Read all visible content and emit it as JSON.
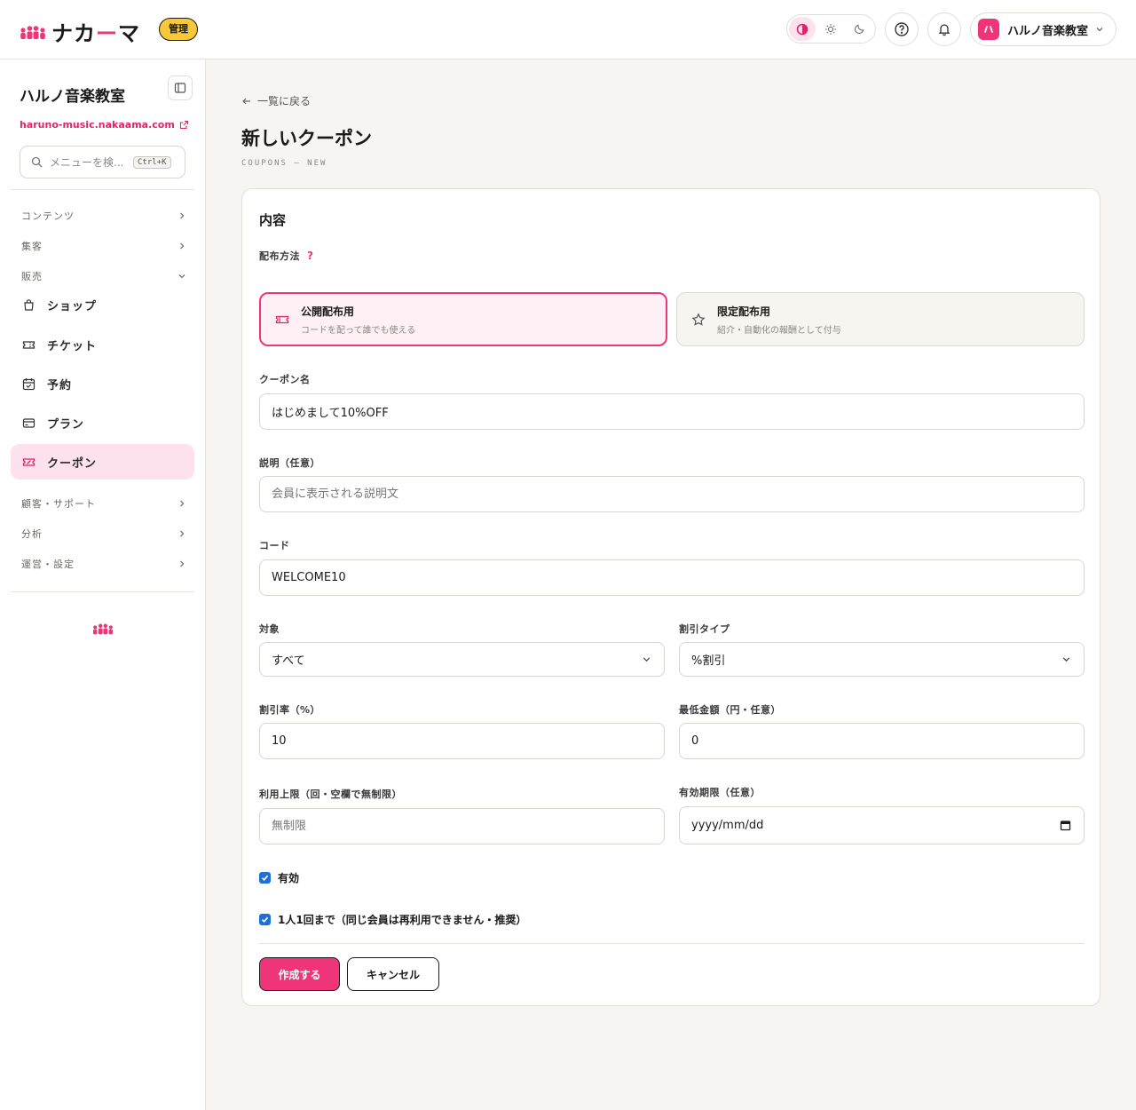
{
  "header": {
    "logo_text_a": "ナカ",
    "logo_text_accent": "ー",
    "logo_text_b": "マ",
    "admin_badge": "管理",
    "account_avatar_letter": "ハ",
    "account_name": "ハルノ音楽教室"
  },
  "sidebar": {
    "title": "ハルノ音楽教室",
    "url": "haruno-music.nakaama.com",
    "search_placeholder": "メニューを検...",
    "search_shortcut": "Ctrl+K",
    "sections": [
      {
        "label": "コンテンツ"
      },
      {
        "label": "集客"
      },
      {
        "label": "販売"
      },
      {
        "label": "顧客・サポート"
      },
      {
        "label": "分析"
      },
      {
        "label": "運営・設定"
      }
    ],
    "items": [
      {
        "label": "ショップ"
      },
      {
        "label": "チケット"
      },
      {
        "label": "予約"
      },
      {
        "label": "プラン"
      },
      {
        "label": "クーポン"
      }
    ]
  },
  "page": {
    "back_label": "一覧に戻る",
    "title": "新しいクーポン",
    "subtitle": "COUPONS — NEW"
  },
  "form": {
    "section_title": "内容",
    "distribution_label": "配布方法",
    "distribution_help": "?",
    "distribution_options": [
      {
        "title": "公開配布用",
        "desc": "コードを配って誰でも使える",
        "selected": true
      },
      {
        "title": "限定配布用",
        "desc": "紹介・自動化の報酬として付与",
        "selected": false
      }
    ],
    "name_label": "クーポン名",
    "name_value": "はじめまして10%OFF",
    "description_label": "説明（任意）",
    "description_placeholder": "会員に表示される説明文",
    "code_label": "コード",
    "code_value": "WELCOME10",
    "target_label": "対象",
    "target_value": "すべて",
    "discount_type_label": "割引タイプ",
    "discount_type_value": "%割引",
    "rate_label": "割引率（%）",
    "rate_value": "10",
    "min_amount_label": "最低金額（円・任意）",
    "min_amount_value": "0",
    "limit_label": "利用上限（回・空欄で無制限）",
    "limit_placeholder": "無制限",
    "expiry_label": "有効期限（任意）",
    "expiry_placeholder": "yyyy/mm/dd",
    "active_label": "有効",
    "once_label": "1人1回まで（同じ会員は再利用できません・推奨）",
    "submit_label": "作成する",
    "cancel_label": "キャンセル"
  },
  "colors": {
    "accent": "#f0347a",
    "accent_soft": "#fde1ec",
    "badge": "#f7c83a",
    "checkbox": "#1f6fd6"
  }
}
